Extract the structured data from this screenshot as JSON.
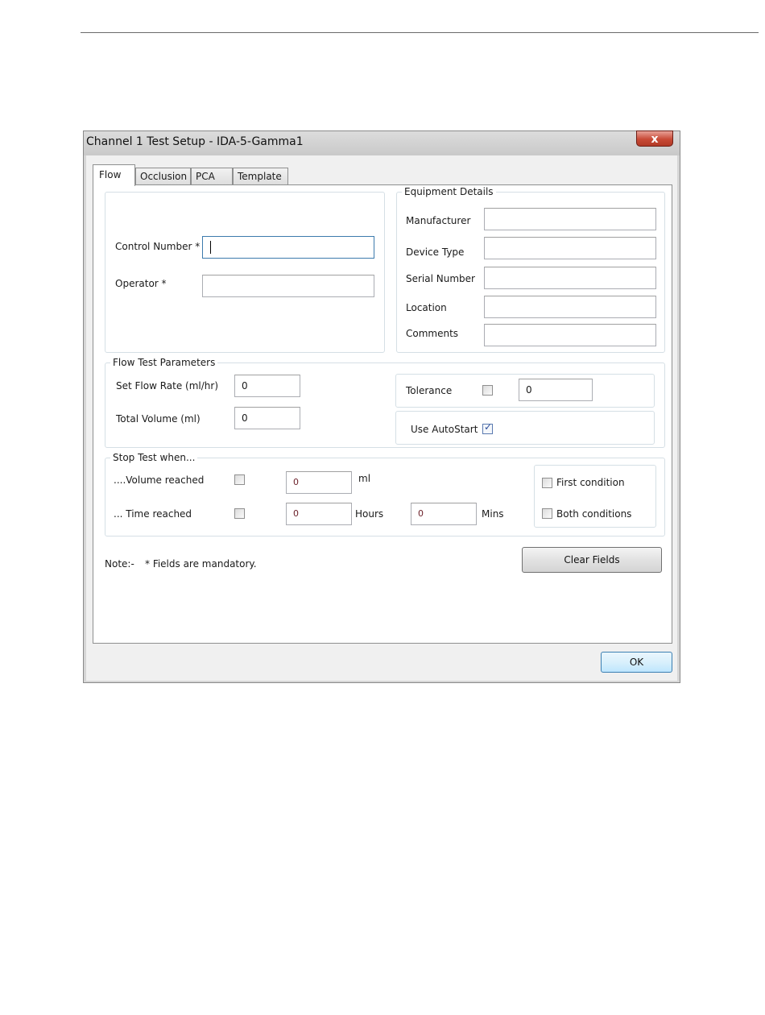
{
  "window": {
    "title": "Channel 1 Test Setup - IDA-5-Gamma1",
    "close_glyph": "x"
  },
  "tabs": [
    {
      "label": "Flow",
      "active": true
    },
    {
      "label": "Occlusion",
      "active": false
    },
    {
      "label": "PCA",
      "active": false
    },
    {
      "label": "Template",
      "active": false
    }
  ],
  "identity": {
    "control_number_label": "Control Number *",
    "control_number_value": "",
    "operator_label": "Operator *",
    "operator_value": ""
  },
  "equipment": {
    "title": "Equipment Details",
    "manufacturer_label": "Manufacturer",
    "device_type_label": "Device Type",
    "serial_number_label": "Serial Number",
    "location_label": "Location",
    "comments_label": "Comments"
  },
  "flow_params": {
    "title": "Flow Test Parameters",
    "flow_rate_label": "Set Flow Rate (ml/hr)",
    "flow_rate_value": "0",
    "total_volume_label": "Total Volume (ml)",
    "total_volume_value": "0",
    "tolerance_label": "Tolerance",
    "tolerance_checked": false,
    "tolerance_value": "0",
    "autostart_label": "Use AutoStart",
    "autostart_checked": true
  },
  "stop_test": {
    "title": "Stop Test when...",
    "volume_label": "....Volume reached",
    "volume_value": "0",
    "volume_unit": "ml",
    "time_label": "... Time reached",
    "hours_value": "0",
    "hours_unit": "Hours",
    "mins_value": "0",
    "mins_unit": "Mins",
    "first_condition_label": "First condition",
    "both_conditions_label": "Both conditions"
  },
  "note": {
    "prefix": "Note:-",
    "text": "*  Fields are mandatory."
  },
  "buttons": {
    "clear_fields": "Clear Fields",
    "ok": "OK"
  }
}
